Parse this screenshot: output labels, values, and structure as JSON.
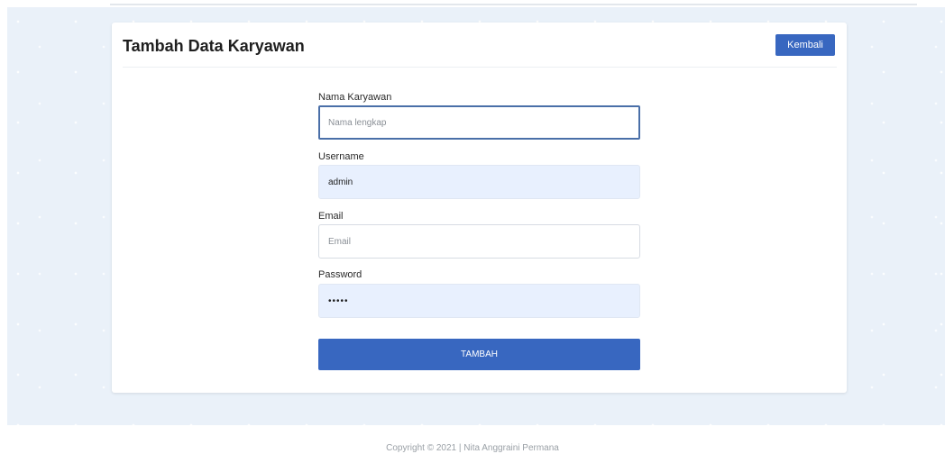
{
  "header": {
    "title": "Tambah Data Karyawan",
    "back_label": "Kembali"
  },
  "form": {
    "nama": {
      "label": "Nama Karyawan",
      "placeholder": "Nama lengkap",
      "value": ""
    },
    "username": {
      "label": "Username",
      "placeholder": "",
      "value": "admin"
    },
    "email": {
      "label": "Email",
      "placeholder": "Email",
      "value": ""
    },
    "password": {
      "label": "Password",
      "placeholder": "",
      "value": "•••••"
    },
    "submit_label": "TAMBAH"
  },
  "footer": {
    "text": "Copyright © 2021 | Nita Anggraini Permana"
  },
  "colors": {
    "primary": "#3867c0",
    "background": "#eaf1f9",
    "autofill": "#e8f0fe"
  }
}
